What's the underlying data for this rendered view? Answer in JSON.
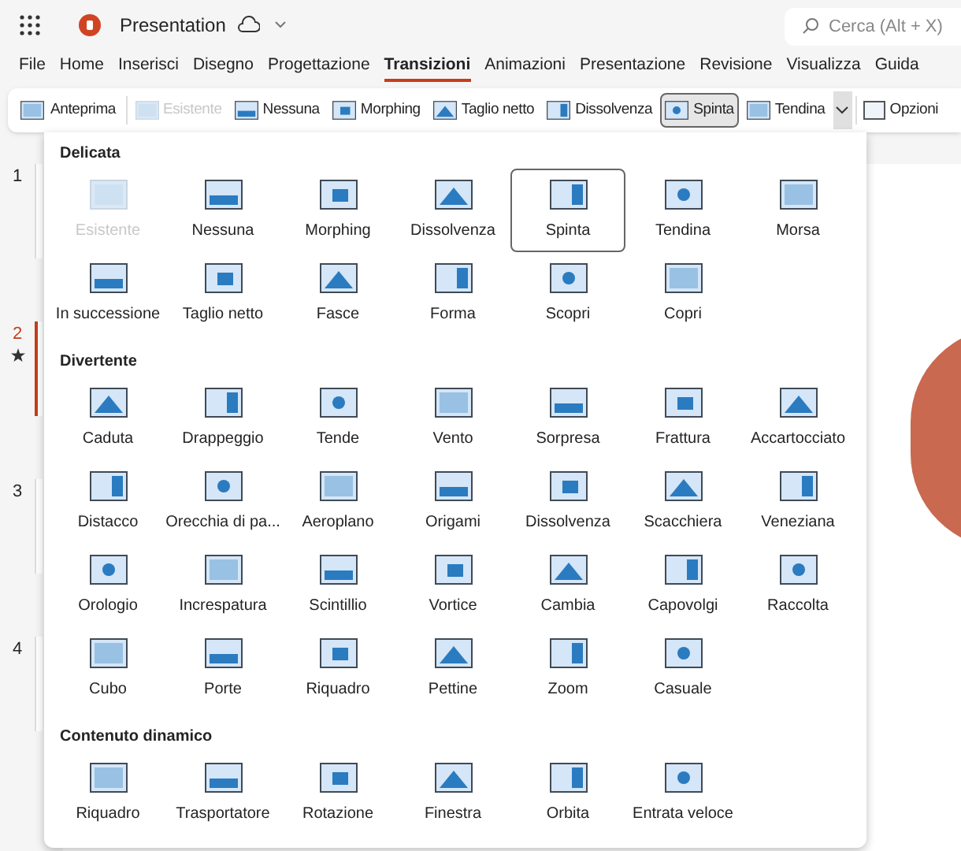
{
  "app": {
    "title": "Presentation",
    "search": {
      "placeholder": "Cerca (Alt + X)"
    }
  },
  "menu": [
    {
      "label": "File",
      "selected": false
    },
    {
      "label": "Home",
      "selected": false
    },
    {
      "label": "Inserisci",
      "selected": false
    },
    {
      "label": "Disegno",
      "selected": false
    },
    {
      "label": "Progettazione",
      "selected": false
    },
    {
      "label": "Transizioni",
      "selected": true
    },
    {
      "label": "Animazioni",
      "selected": false
    },
    {
      "label": "Presentazione",
      "selected": false
    },
    {
      "label": "Revisione",
      "selected": false
    },
    {
      "label": "Visualizza",
      "selected": false
    },
    {
      "label": "Guida",
      "selected": false
    }
  ],
  "ribbon": {
    "preview": "Anteprima",
    "gallery_expanded": true,
    "items": [
      {
        "label": "Esistente",
        "disabled": true,
        "selected": false
      },
      {
        "label": "Nessuna",
        "disabled": false,
        "selected": false
      },
      {
        "label": "Morphing",
        "disabled": false,
        "selected": false
      },
      {
        "label": "Taglio netto",
        "disabled": false,
        "selected": false
      },
      {
        "label": "Dissolvenza",
        "disabled": false,
        "selected": false
      },
      {
        "label": "Spinta",
        "disabled": false,
        "selected": true
      },
      {
        "label": "Tendina",
        "disabled": false,
        "selected": false
      }
    ],
    "options": "Opzioni"
  },
  "slides": [
    {
      "number": "1",
      "selected": false,
      "transition": false
    },
    {
      "number": "2",
      "selected": true,
      "transition": true
    },
    {
      "number": "3",
      "selected": false,
      "transition": false
    },
    {
      "number": "4",
      "selected": false,
      "transition": false
    }
  ],
  "gallery": [
    {
      "title": "Delicata",
      "items": [
        {
          "label": "Esistente",
          "disabled": true,
          "selected": false
        },
        {
          "label": "Nessuna",
          "disabled": false,
          "selected": false
        },
        {
          "label": "Morphing",
          "disabled": false,
          "selected": false
        },
        {
          "label": "Dissolvenza",
          "disabled": false,
          "selected": false
        },
        {
          "label": "Spinta",
          "disabled": false,
          "selected": true
        },
        {
          "label": "Tendina",
          "disabled": false,
          "selected": false
        },
        {
          "label": "Morsa",
          "disabled": false,
          "selected": false
        },
        {
          "label": "In successione",
          "disabled": false,
          "selected": false
        },
        {
          "label": "Taglio netto",
          "disabled": false,
          "selected": false
        },
        {
          "label": "Fasce",
          "disabled": false,
          "selected": false
        },
        {
          "label": "Forma",
          "disabled": false,
          "selected": false
        },
        {
          "label": "Scopri",
          "disabled": false,
          "selected": false
        },
        {
          "label": "Copri",
          "disabled": false,
          "selected": false
        }
      ]
    },
    {
      "title": "Divertente",
      "items": [
        {
          "label": "Caduta",
          "disabled": false,
          "selected": false
        },
        {
          "label": "Drappeggio",
          "disabled": false,
          "selected": false
        },
        {
          "label": "Tende",
          "disabled": false,
          "selected": false
        },
        {
          "label": "Vento",
          "disabled": false,
          "selected": false
        },
        {
          "label": "Sorpresa",
          "disabled": false,
          "selected": false
        },
        {
          "label": "Frattura",
          "disabled": false,
          "selected": false
        },
        {
          "label": "Accartocciato",
          "disabled": false,
          "selected": false
        },
        {
          "label": "Distacco",
          "disabled": false,
          "selected": false
        },
        {
          "label": "Orecchia di pa...",
          "disabled": false,
          "selected": false
        },
        {
          "label": "Aeroplano",
          "disabled": false,
          "selected": false
        },
        {
          "label": "Origami",
          "disabled": false,
          "selected": false
        },
        {
          "label": "Dissolvenza",
          "disabled": false,
          "selected": false
        },
        {
          "label": "Scacchiera",
          "disabled": false,
          "selected": false
        },
        {
          "label": "Veneziana",
          "disabled": false,
          "selected": false
        },
        {
          "label": "Orologio",
          "disabled": false,
          "selected": false
        },
        {
          "label": "Increspatura",
          "disabled": false,
          "selected": false
        },
        {
          "label": "Scintillio",
          "disabled": false,
          "selected": false
        },
        {
          "label": "Vortice",
          "disabled": false,
          "selected": false
        },
        {
          "label": "Cambia",
          "disabled": false,
          "selected": false
        },
        {
          "label": "Capovolgi",
          "disabled": false,
          "selected": false
        },
        {
          "label": "Raccolta",
          "disabled": false,
          "selected": false
        },
        {
          "label": "Cubo",
          "disabled": false,
          "selected": false
        },
        {
          "label": "Porte",
          "disabled": false,
          "selected": false
        },
        {
          "label": "Riquadro",
          "disabled": false,
          "selected": false
        },
        {
          "label": "Pettine",
          "disabled": false,
          "selected": false
        },
        {
          "label": "Zoom",
          "disabled": false,
          "selected": false
        },
        {
          "label": "Casuale",
          "disabled": false,
          "selected": false
        }
      ]
    },
    {
      "title": "Contenuto dinamico",
      "items": [
        {
          "label": "Riquadro",
          "disabled": false,
          "selected": false
        },
        {
          "label": "Trasportatore",
          "disabled": false,
          "selected": false
        },
        {
          "label": "Rotazione",
          "disabled": false,
          "selected": false
        },
        {
          "label": "Finestra",
          "disabled": false,
          "selected": false
        },
        {
          "label": "Orbita",
          "disabled": false,
          "selected": false
        },
        {
          "label": "Entrata veloce",
          "disabled": false,
          "selected": false
        }
      ]
    }
  ]
}
